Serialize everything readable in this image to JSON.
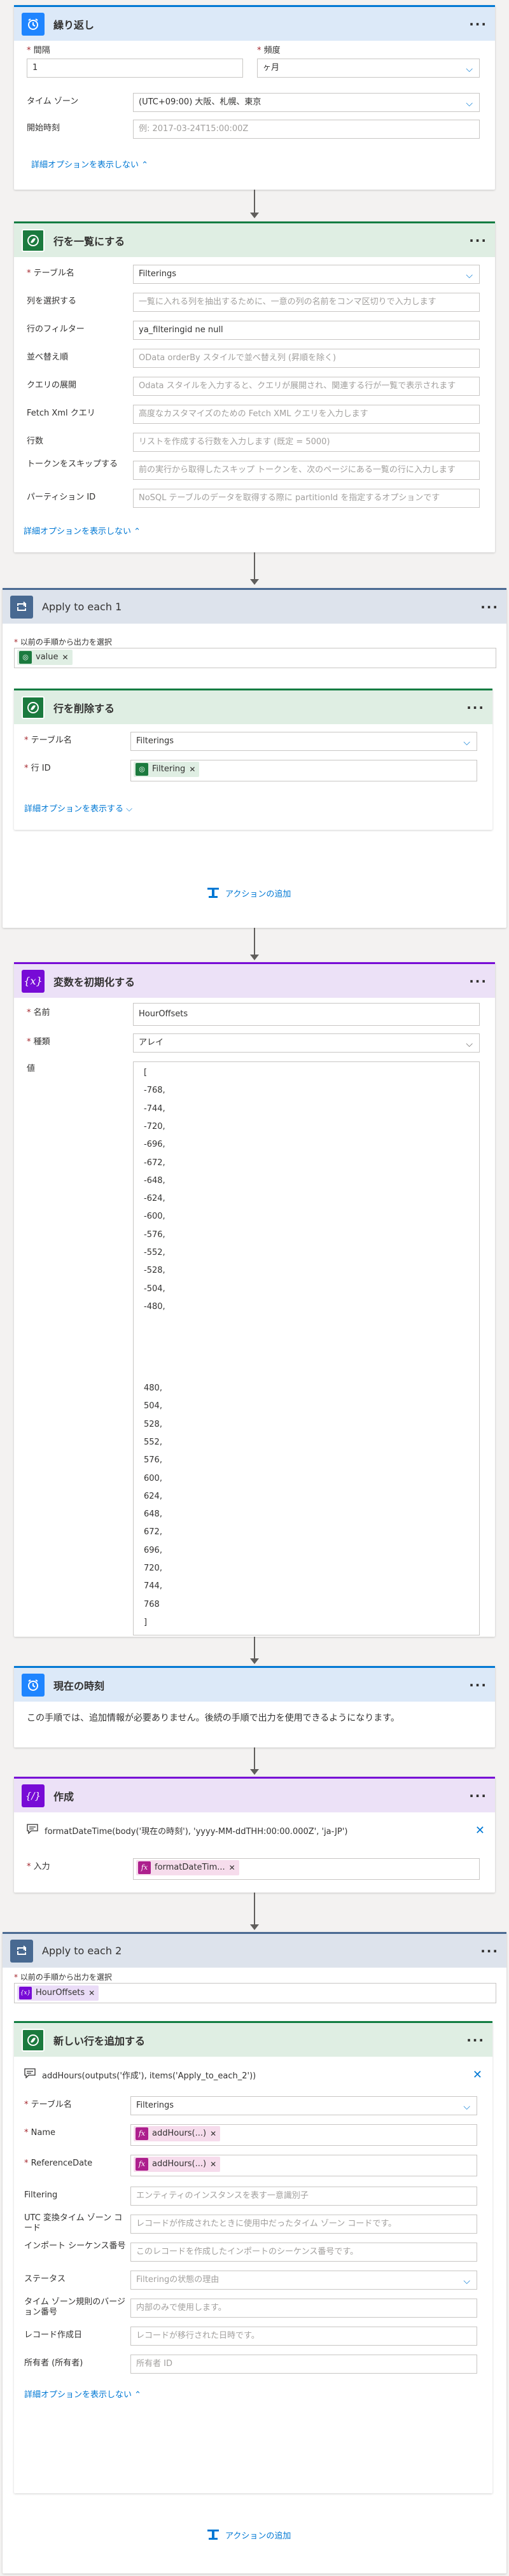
{
  "recurrence": {
    "title": "繰り返し",
    "interval_label": "間隔",
    "interval_value": "1",
    "frequency_label": "頻度",
    "frequency_value": "ヶ月",
    "timezone_label": "タイム ゾーン",
    "timezone_value": "(UTC+09:00) 大阪、札幌、東京",
    "start_label": "開始時刻",
    "start_placeholder": "例: 2017-03-24T15:00:00Z",
    "hide_advanced": "詳細オプションを表示しない"
  },
  "list_rows": {
    "title": "行を一覧にする",
    "table_label": "テーブル名",
    "table_value": "Filterings",
    "select_label": "列を選択する",
    "select_placeholder": "一覧に入れる列を抽出するために、一意の列の名前をコンマ区切りで入力します",
    "filter_label": "行のフィルター",
    "filter_value": "ya_filteringid ne null",
    "sort_label": "並べ替え順",
    "sort_placeholder": "OData orderBy スタイルで並べ替え",
    "sort_placeholder_full": "OData orderBy スタイルで並べ替え列 (昇順を除く)",
    "expand_label": "クエリの展開",
    "expand_placeholder": "Odata スタイルを入力すると、クエリが展開され、関連する行が一覧で表示されます",
    "fetch_label": "Fetch Xml クエリ",
    "fetch_placeholder": "高度なカスタマイズのための Fetch XML クエリを入力します",
    "count_label": "行数",
    "count_placeholder": "リストを作成する行数を入力します (既定 = 5000)",
    "skip_label": "トークンをスキップする",
    "skip_placeholder": "前の実行から取得したスキップ トークンを、次のページにある一覧の行に入力します",
    "partition_label": "パーティション ID",
    "partition_placeholder": "NoSQL テーブルのデータを取得する際に partitionId を指定するオプションです",
    "hide_advanced": "詳細オプションを表示しない"
  },
  "apply1": {
    "title": "Apply to each 1",
    "select_output_label": "以前の手順から出力を選択",
    "token": "value",
    "delete_row": {
      "title": "行を削除する",
      "table_label": "テーブル名",
      "table_value": "Filterings",
      "rowid_label": "行 ID",
      "rowid_token": "Filtering",
      "show_advanced": "詳細オプションを表示する"
    },
    "add_action": "アクションの追加"
  },
  "init_var": {
    "title": "変数を初期化する",
    "name_label": "名前",
    "name_value": "HourOffsets",
    "type_label": "種類",
    "type_value": "アレイ",
    "value_label": "値",
    "values_top": [
      "[",
      "-768,",
      "-744,",
      "-720,",
      "-696,",
      "-672,",
      "-648,",
      "-624,",
      "-600,",
      "-576,",
      "-552,",
      "-528,",
      "-504,",
      "-480,"
    ],
    "values_bottom": [
      "480,",
      "504,",
      "528,",
      "552,",
      "576,",
      "600,",
      "624,",
      "648,",
      "672,",
      "696,",
      "720,",
      "744,",
      "768",
      "]"
    ]
  },
  "current_time": {
    "title": "現在の時刻",
    "message": "この手順では、追加情報が必要ありません。後続の手順で出力を使用できるようになります。"
  },
  "compose": {
    "title": "作成",
    "expression": "formatDateTime(body('現在の時刻'), 'yyyy-MM-ddTHH:00:00.000Z', 'ja-JP')",
    "input_label": "入力",
    "input_token": "formatDateTim..."
  },
  "apply2": {
    "title": "Apply to each 2",
    "select_output_label": "以前の手順から出力を選択",
    "token": "HourOffsets",
    "add_row": {
      "title": "新しい行を追加する",
      "expression": "addHours(outputs('作成'), items('Apply_to_each_2'))",
      "table_label": "テーブル名",
      "table_value": "Filterings",
      "name_label": "Name",
      "name_token": "addHours(...)",
      "refdate_label": "ReferenceDate",
      "refdate_token": "addHours(...)",
      "filtering_label": "Filtering",
      "filtering_placeholder": "エンティティのインスタンスを表す一意識別子",
      "utc_label": "UTC 変換タイム ゾーン コード",
      "utc_placeholder": "レコードが作成されたときに使用中だったタイム ゾーン コードです。",
      "import_label": "インポート シーケンス番号",
      "import_placeholder": "このレコードを作成したインポートのシーケンス番号です。",
      "status_label": "ステータス",
      "status_placeholder": "Filteringの状態の理由",
      "tzrule_label": "タイム ゾーン規則のバージョン番号",
      "tzrule_placeholder": "内部のみで使用します。",
      "created_label": "レコード作成日",
      "created_placeholder": "レコードが移行された日時です。",
      "owner_label": "所有者 (所有者)",
      "owner_placeholder": "所有者 ID",
      "hide_advanced": "詳細オプションを表示しない"
    },
    "add_action": "アクションの追加"
  },
  "colors": {
    "accent": "#0078d4",
    "dataverse": "#1b7a3e",
    "variable": "#770bd6",
    "control": "#486991",
    "expression": "#ad1f8d",
    "required": "#a4262c"
  }
}
